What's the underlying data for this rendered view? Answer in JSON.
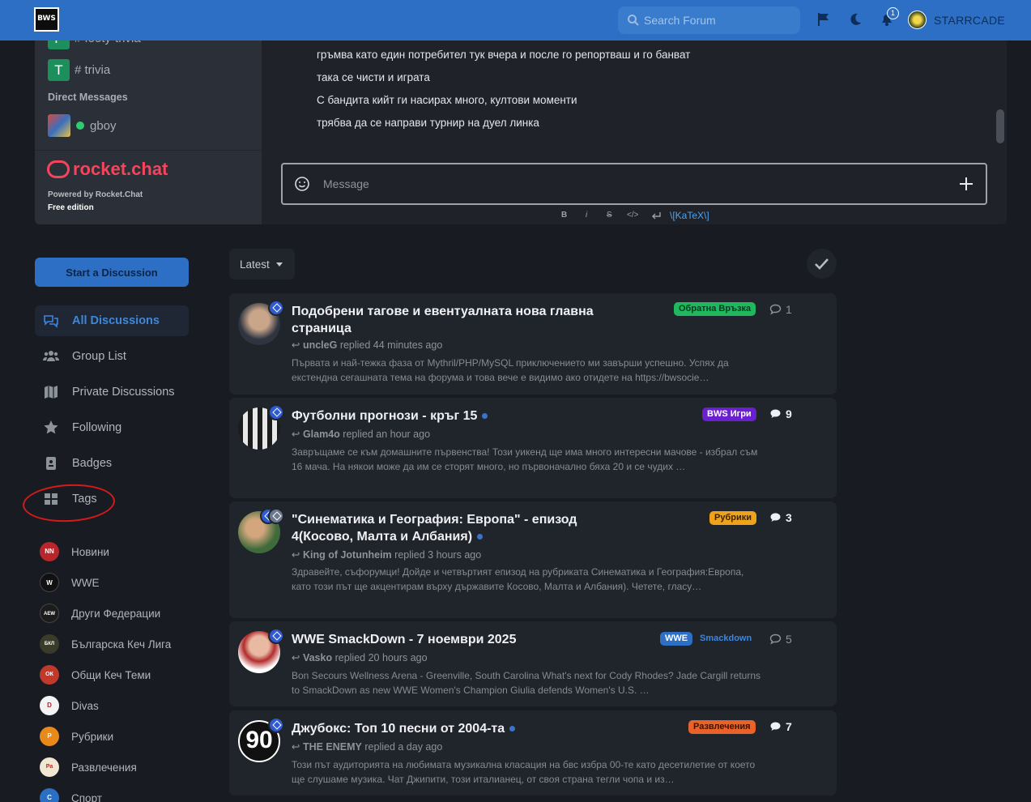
{
  "header": {
    "logo_text": "BWS",
    "search_placeholder": "Search Forum",
    "notification_count": "1",
    "username": "STARRCADE"
  },
  "chat": {
    "channels": [
      {
        "letter": "F",
        "name": "# footy-trivia"
      },
      {
        "letter": "T",
        "name": "# trivia"
      }
    ],
    "dm_title": "Direct Messages",
    "dm_user": "gboy",
    "brand": "rocket.chat",
    "powered": "Powered by Rocket.Chat",
    "edition": "Free edition",
    "messages": [
      "гръмва като един потребител тук вчера и после го репортваш и го банват",
      "така се чисти и играта",
      "С бандита кийт ги насирах много, култови моменти",
      "трябва да се направи турнир на дуел линка"
    ],
    "composer_placeholder": "Message",
    "format_bold": "B",
    "format_italic": "i",
    "format_strike": "S",
    "format_code": "</>",
    "katex": "\\[KaTeX\\]"
  },
  "sidebar": {
    "start_button": "Start a Discussion",
    "nav": [
      {
        "label": "All Discussions",
        "icon": "comments-icon"
      },
      {
        "label": "Group List",
        "icon": "users-icon"
      },
      {
        "label": "Private Discussions",
        "icon": "map-icon"
      },
      {
        "label": "Following",
        "icon": "star-icon"
      },
      {
        "label": "Badges",
        "icon": "badge-icon"
      },
      {
        "label": "Tags",
        "icon": "grid-icon"
      }
    ],
    "categories": [
      {
        "label": "Новини",
        "color": "#b8262b",
        "short": "NN"
      },
      {
        "label": "WWE",
        "color": "#111111",
        "short": "W"
      },
      {
        "label": "Други Федерации",
        "color": "#1c1c1c",
        "short": "AEW"
      },
      {
        "label": "Българска Кеч Лига",
        "color": "#3b3b2a",
        "short": "БКЛ"
      },
      {
        "label": "Общи Кеч Теми",
        "color": "#c0392b",
        "short": "ОК"
      },
      {
        "label": "Divas",
        "color": "#f3f3f3",
        "short": "D"
      },
      {
        "label": "Рубрики",
        "color": "#e8891c",
        "short": "Р"
      },
      {
        "label": "Развлечения",
        "color": "#f0e6d2",
        "short": "Ра"
      },
      {
        "label": "Спорт",
        "color": "#2a6fc4",
        "short": "С"
      }
    ]
  },
  "list": {
    "sort_label": "Latest",
    "topics": [
      {
        "title": "Подобрени тагове и евентуалната нова главна страница",
        "user": "uncleG",
        "action": "replied 44 minutes ago",
        "excerpt": "Първата и най-тежка фаза от Mythril/PHP/MySQL приключението ми завърши успешно. Успях да екстендна сегашната тема на форума и това вече е видимо ако отидете на https://bwsocie…",
        "tags": [
          {
            "label": "Обратна Връзка",
            "color": "#1fb85e",
            "text": "#0b3a1f"
          }
        ],
        "replies": "1",
        "unread": false
      },
      {
        "title": "Футболни прогнози - кръг 15",
        "user": "Glam4o",
        "action": "replied an hour ago",
        "excerpt": "Завръщаме се към домашните първенства! Този уикенд ще има много интересни мачове - избрал съм 16 мача. На някои може да им се сторят много, но първоначално бяха 20 и се чудих …",
        "tags": [
          {
            "label": "BWS Игри",
            "color": "#6a1fd1",
            "text": "#ffffff"
          }
        ],
        "replies": "9",
        "unread": true
      },
      {
        "title": "\"Синематика и География: Европа\" - епизод 4(Косово, Малта и Албания)",
        "user": "King of Jotunheim",
        "action": "replied 3 hours ago",
        "excerpt": "Здравейте, съфорумци! Дойде и четвъртият епизод на рубриката Синематика и География:Европа, като този път ще акцентирам върху държавите Косово, Малта и Албания). Четете, гласу…",
        "tags": [
          {
            "label": "Рубрики",
            "color": "#f0a31a",
            "text": "#3a2400"
          }
        ],
        "replies": "3",
        "unread": true
      },
      {
        "title": "WWE SmackDown - 7 ноември 2025",
        "user": "Vasko",
        "action": "replied 20 hours ago",
        "excerpt": "Bon Secours Wellness Arena - Greenville, South Carolina What's next for Cody Rhodes? Jade Cargill returns to SmackDown as new WWE Women's Champion Giulia defends Women's U.S. …",
        "tags": [
          {
            "label": "WWE",
            "color": "#2c6fc4",
            "text": "#ffffff"
          },
          {
            "label": "Smackdown",
            "color": "transparent",
            "text": "#3d86dc"
          }
        ],
        "replies": "5",
        "unread": false
      },
      {
        "title": "Джубокс: Топ 10 песни от 2004-та",
        "user": "THE ENEMY",
        "action": "replied a day ago",
        "excerpt": "Този път аудиторията на любимата музикална класация на бвс избра 00-те като десетилетие от което ще слушаме музика. Чат Джипити, този италианец, от своя страна тегли чопа и из…",
        "tags": [
          {
            "label": "Развлечения",
            "color": "#e8622a",
            "text": "#3a1300"
          }
        ],
        "replies": "7",
        "unread": true
      }
    ]
  }
}
